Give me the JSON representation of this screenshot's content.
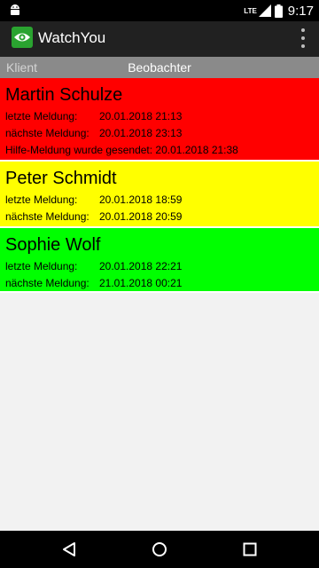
{
  "status_bar": {
    "network": "LTE",
    "time": "9:17"
  },
  "app_bar": {
    "title": "WatchYou"
  },
  "tabs": {
    "client": "Klient",
    "observer": "Beobachter"
  },
  "entries": [
    {
      "name": "Martin Schulze",
      "color": "#ff0000",
      "last_label": "letzte Meldung:",
      "last_value": "20.01.2018 21:13",
      "next_label": "nächste Meldung:",
      "next_value": "20.01.2018 23:13",
      "alert": "Hilfe-Meldung wurde gesendet: 20.01.2018 21:38"
    },
    {
      "name": "Peter Schmidt",
      "color": "#ffff00",
      "last_label": "letzte Meldung:",
      "last_value": "20.01.2018 18:59",
      "next_label": "nächste Meldung:",
      "next_value": "20.01.2018 20:59"
    },
    {
      "name": "Sophie Wolf",
      "color": "#00ff00",
      "last_label": "letzte Meldung:",
      "last_value": "20.01.2018 22:21",
      "next_label": "nächste Meldung:",
      "next_value": "21.01.2018 00:21"
    }
  ]
}
